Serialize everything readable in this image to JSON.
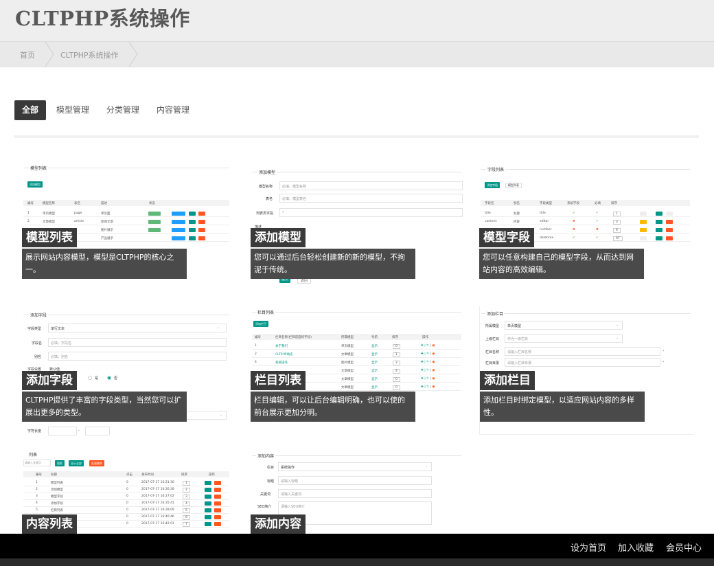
{
  "site": {
    "title": "CLTPHP系统操作"
  },
  "breadcrumb": {
    "home": "首页",
    "current": "CLTPHP系统操作"
  },
  "tabs": [
    {
      "label": "全部",
      "active": true
    },
    {
      "label": "模型管理",
      "active": false
    },
    {
      "label": "分类管理",
      "active": false
    },
    {
      "label": "内容管理",
      "active": false
    }
  ],
  "cards": [
    {
      "title": "模型列表",
      "desc": "展示网站内容模型，模型是CLTPHP的核心之一。",
      "mock": "模型列表"
    },
    {
      "title": "添加模型",
      "desc": "您可以通过后台轻松创建新的新的模型，不拘泥于传统。",
      "mock": "添加模型"
    },
    {
      "title": "模型字段",
      "desc": "您可以任意构建自己的模型字段，从而达到网站内容的高效编辑。",
      "mock": "字段列表"
    },
    {
      "title": "添加字段",
      "desc": "CLTPHP提供了丰富的字段类型，当然您可以扩展出更多的类型。",
      "mock": "添加字段"
    },
    {
      "title": "栏目列表",
      "desc": "栏目编辑，可以让后台编辑明确，也可以使的前台展示更加分明。",
      "mock": "栏目列表"
    },
    {
      "title": "添加栏目",
      "desc": "添加栏目时绑定模型，以适应网站内容的多样性。",
      "mock": "添加栏目"
    },
    {
      "title": "内容列表",
      "desc": "",
      "mock": "列表"
    },
    {
      "title": "添加内容",
      "desc": "",
      "mock": "添加内容"
    }
  ],
  "mock": {
    "add_btn": "添加模型",
    "add_field_btn": "添加字段",
    "model_list_btn": "模型列表",
    "add_cat_btn": "添加栏目",
    "model_headers": [
      "编号",
      "模型名称",
      "表名",
      "描述",
      "状态"
    ],
    "model_rows": [
      [
        "1",
        "单页模型",
        "page",
        "单页面"
      ],
      [
        "2",
        "文章模型",
        "article",
        "新闻文章"
      ],
      [
        "3",
        "图片模型",
        "picture",
        "图片展示"
      ],
      [
        "4",
        "产品模型",
        "product",
        "产品展示"
      ]
    ],
    "add_model_fields": [
      {
        "label": "模型名称",
        "placeholder": "必填。模型名称"
      },
      {
        "label": "表名",
        "placeholder": "必填。模型表名"
      },
      {
        "label": "列表页字段",
        "placeholder": "*"
      },
      {
        "label": "描述",
        "placeholder": ""
      }
    ],
    "submit": "提交",
    "back": "返回",
    "field_headers": [
      "字段名",
      "别名",
      "字段类型",
      "系统字段",
      "必填",
      "排序"
    ],
    "field_rows": [
      [
        "title",
        "标题",
        "title",
        "1"
      ],
      [
        "content",
        "内容",
        "editor",
        "3"
      ],
      [
        "hits",
        "点击",
        "number",
        "6"
      ],
      [
        "createtime",
        "发布时间",
        "datetime",
        "97"
      ]
    ],
    "add_field_rows": [
      {
        "label": "字段类型",
        "value": "单行文本"
      },
      {
        "label": "字段名",
        "value": "必填，字段名"
      },
      {
        "label": "别名",
        "value": "必填，别名"
      },
      {
        "label": "字段设置",
        "value": "默认值"
      },
      {
        "label": "字符长度",
        "value": "-"
      }
    ],
    "radio_yes": "是",
    "radio_no": "否",
    "cat_headers": [
      "编号",
      "栏目名称(栏目前面的字段)",
      "所属模型",
      "导航",
      "排序",
      "操作"
    ],
    "cat_rows": [
      [
        "1",
        "关于我们",
        "单页模型",
        "显示",
        "0"
      ],
      [
        "2",
        "CLTPHP动态",
        "文章模型",
        "显示",
        "1"
      ],
      [
        "4",
        "系统操作",
        "图片模型",
        "显示",
        "2"
      ],
      [
        "5",
        "",
        "文章模型",
        "显示",
        "4"
      ],
      [
        "6",
        "",
        "文章模型",
        "显示",
        "0"
      ],
      [
        "7",
        "",
        "文章模型",
        "显示",
        "0"
      ]
    ],
    "add_cat_rows": [
      {
        "label": "所属模型",
        "value": "单页模型"
      },
      {
        "label": "上级栏目",
        "value": "作为一级栏目"
      },
      {
        "label": "栏目名称",
        "value": "请输入栏目名称"
      },
      {
        "label": "栏目目录",
        "value": "请输入栏目目录"
      }
    ],
    "content_search_placeholder": "请输入关键字",
    "content_btns": [
      "搜索",
      "显示全部",
      "批量删除"
    ],
    "content_headers": [
      "编号",
      "标题",
      "点击",
      "发布时间",
      "排序",
      "操作"
    ],
    "content_rows": [
      [
        "1",
        "模型列表",
        "0",
        "2017-07-17 16:21:30",
        "1"
      ],
      [
        "2",
        "添加模型",
        "0",
        "2017-07-17 16:26:28",
        "2"
      ],
      [
        "3",
        "模型字段",
        "0",
        "2017-07-17 16:27:02",
        "3"
      ],
      [
        "4",
        "添加字段",
        "0",
        "2017-07-17 16:35:41",
        "4"
      ],
      [
        "5",
        "栏目列表",
        "0",
        "2017-07-17 16:39:09",
        "5"
      ],
      [
        "6",
        "添加栏目",
        "0",
        "2017-07-17 16:40:46",
        "6"
      ],
      [
        "7",
        "内容列表",
        "0",
        "2017-07-17 16:42:01",
        "7"
      ]
    ],
    "add_content_rows": [
      {
        "label": "栏目",
        "value": "系统操作"
      },
      {
        "label": "标题",
        "value": "请输入标题"
      },
      {
        "label": "关键词",
        "value": "请输入关键词"
      },
      {
        "label": "SEO简介",
        "value": "请输入SEO简介"
      }
    ]
  },
  "footer": {
    "links": [
      "设为首页",
      "加入收藏",
      "会员中心"
    ]
  },
  "colors": {
    "green": "#009688",
    "orange": "#FF5722",
    "yellow": "#FFB800",
    "blue": "#1E9FFF",
    "check": "#5FB878",
    "cross": "#FF5722"
  }
}
